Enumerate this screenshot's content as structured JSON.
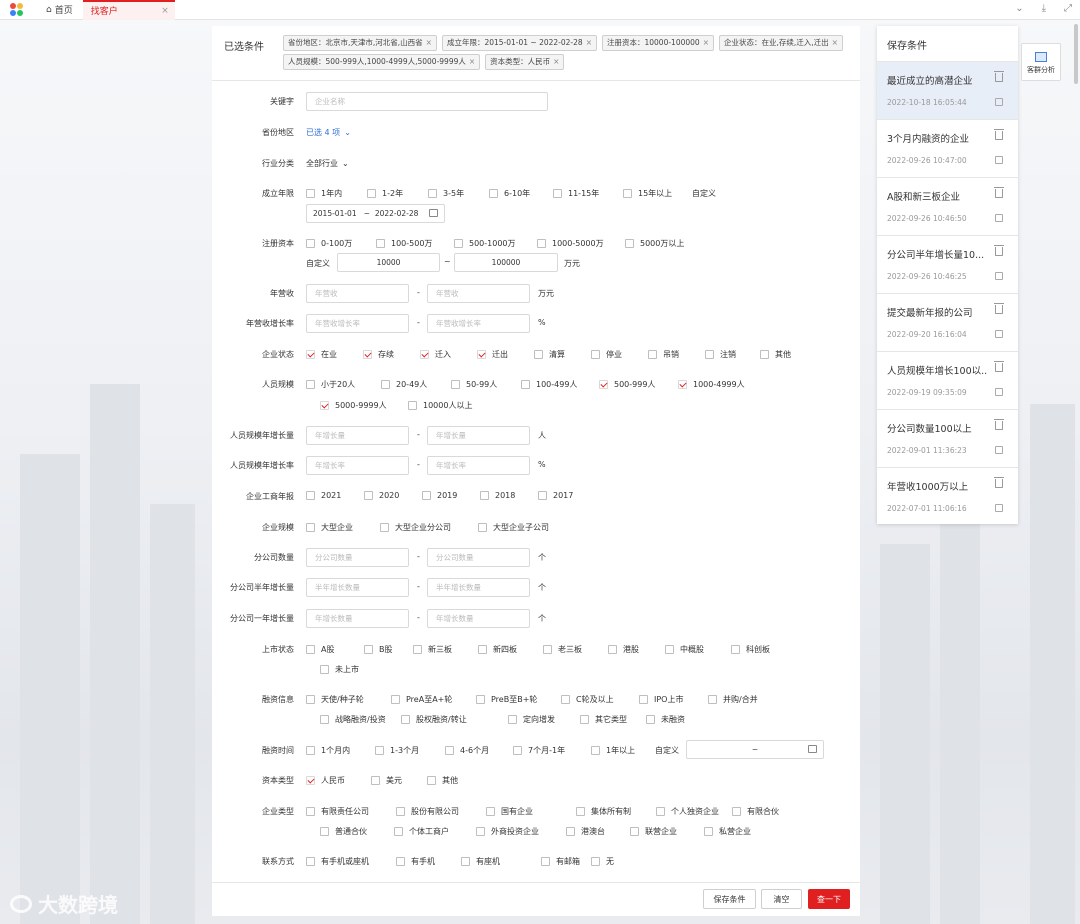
{
  "nav": {
    "home": "首页",
    "tab": "找客户"
  },
  "chosen": {
    "title": "已选条件",
    "tags": [
      "省份地区：北京市,天津市,河北省,山西省",
      "成立年限：2015-01-01 ~ 2022-02-28",
      "注册资本：10000-100000",
      "企业状态：在业,存续,迁入,迁出",
      "人员规模：500-999人,1000-4999人,5000-9999人",
      "资本类型：人民币"
    ]
  },
  "form": {
    "keyword": {
      "label": "关键字",
      "placeholder": "企业名称"
    },
    "province": {
      "label": "省份地区",
      "value": "已选 4 项"
    },
    "industry": {
      "label": "行业分类",
      "value": "全部行业"
    },
    "years": {
      "label": "成立年限",
      "options": [
        "1年内",
        "1-2年",
        "3-5年",
        "6-10年",
        "11-15年",
        "15年以上"
      ],
      "custom": "自定义",
      "from": "2015-01-01",
      "sep": "~",
      "to": "2022-02-28"
    },
    "capital": {
      "label": "注册资本",
      "options": [
        "0-100万",
        "100-500万",
        "500-1000万",
        "1000-5000万",
        "5000万以上"
      ],
      "custom": "自定义",
      "from": "10000",
      "sep": "~",
      "to": "100000",
      "unit": "万元"
    },
    "revenue": {
      "label": "年营收",
      "ph1": "年营收",
      "ph2": "年营收",
      "dash": "-",
      "unit": "万元"
    },
    "revenue_growth": {
      "label": "年营收增长率",
      "ph1": "年营收增长率",
      "ph2": "年营收增长率",
      "dash": "-",
      "unit": "%"
    },
    "status": {
      "label": "企业状态",
      "options": [
        {
          "t": "在业",
          "c": true
        },
        {
          "t": "存续",
          "c": true
        },
        {
          "t": "迁入",
          "c": true
        },
        {
          "t": "迁出",
          "c": true
        },
        {
          "t": "清算",
          "c": false
        },
        {
          "t": "停业",
          "c": false
        },
        {
          "t": "吊销",
          "c": false
        },
        {
          "t": "注销",
          "c": false
        },
        {
          "t": "其他",
          "c": false
        }
      ]
    },
    "staff": {
      "label": "人员规模",
      "options": [
        {
          "t": "小于20人",
          "c": false
        },
        {
          "t": "20-49人",
          "c": false
        },
        {
          "t": "50-99人",
          "c": false
        },
        {
          "t": "100-499人",
          "c": false
        },
        {
          "t": "500-999人",
          "c": true
        },
        {
          "t": "1000-4999人",
          "c": true
        },
        {
          "t": "5000-9999人",
          "c": true
        },
        {
          "t": "10000人以上",
          "c": false
        }
      ]
    },
    "staff_growth": {
      "label": "人员规模年增长量",
      "ph1": "年增长量",
      "ph2": "年增长量",
      "dash": "-",
      "unit": "人"
    },
    "staff_rate": {
      "label": "人员规模年增长率",
      "ph1": "年增长率",
      "ph2": "年增长率",
      "dash": "-",
      "unit": "%"
    },
    "annual_report": {
      "label": "企业工商年报",
      "options": [
        "2021",
        "2020",
        "2019",
        "2018",
        "2017"
      ]
    },
    "scale": {
      "label": "企业规模",
      "options": [
        "大型企业",
        "大型企业分公司",
        "大型企业子公司"
      ]
    },
    "branch_count": {
      "label": "分公司数量",
      "ph1": "分公司数量",
      "ph2": "分公司数量",
      "dash": "-",
      "unit": "个"
    },
    "branch_half": {
      "label": "分公司半年增长量",
      "ph1": "半年增长数量",
      "ph2": "半年增长数量",
      "dash": "-",
      "unit": "个"
    },
    "branch_year": {
      "label": "分公司一年增长量",
      "ph1": "年增长数量",
      "ph2": "年增长数量",
      "dash": "-",
      "unit": "个"
    },
    "listing": {
      "label": "上市状态",
      "options": [
        "A股",
        "B股",
        "新三板",
        "新四板",
        "老三板",
        "港股",
        "中概股",
        "科创板",
        "未上市"
      ]
    },
    "financing": {
      "label": "融资信息",
      "options": [
        "天使/种子轮",
        "PreA至A+轮",
        "PreB至B+轮",
        "C轮及以上",
        "IPO上市",
        "并购/合并",
        "战略融资/投资",
        "股权融资/转让",
        "定向增发",
        "其它类型",
        "未融资"
      ]
    },
    "fin_time": {
      "label": "融资时间",
      "options": [
        "1个月内",
        "1-3个月",
        "4-6个月",
        "7个月-1年",
        "1年以上"
      ],
      "custom": "自定义",
      "sep": "~"
    },
    "cap_type": {
      "label": "资本类型",
      "options": [
        {
          "t": "人民币",
          "c": true
        },
        {
          "t": "美元",
          "c": false
        },
        {
          "t": "其他",
          "c": false
        }
      ]
    },
    "ent_type": {
      "label": "企业类型",
      "options": [
        "有限责任公司",
        "股份有限公司",
        "国有企业",
        "集体所有制",
        "个人独资企业",
        "有限合伙",
        "普通合伙",
        "个体工商户",
        "外商投资企业",
        "港澳台",
        "联营企业",
        "私营企业"
      ]
    },
    "contact": {
      "label": "联系方式",
      "options": [
        "有手机或座机",
        "有手机",
        "有座机",
        "有邮箱",
        "无"
      ]
    }
  },
  "footer": {
    "save": "保存条件",
    "clear": "清空",
    "search": "查一下"
  },
  "saved": {
    "title": "保存条件",
    "items": [
      {
        "name": "最近成立的高潜企业",
        "time": "2022-10-18 16:05:44"
      },
      {
        "name": "3个月内融资的企业",
        "time": "2022-09-26 10:47:00"
      },
      {
        "name": "A股和新三板企业",
        "time": "2022-09-26 10:46:50"
      },
      {
        "name": "分公司半年增长量10...",
        "time": "2022-09-26 10:46:25"
      },
      {
        "name": "提交最新年报的公司",
        "time": "2022-09-20 16:16:04"
      },
      {
        "name": "人员规模年增长100以...",
        "time": "2022-09-19 09:35:09"
      },
      {
        "name": "分公司数量100以上",
        "time": "2022-09-01 11:36:23"
      },
      {
        "name": "年营收1000万以上",
        "time": "2022-07-01 11:06:16"
      }
    ]
  },
  "analysis": "客群分析",
  "watermark": "大数跨境",
  "colors": {
    "accent": "#e02020",
    "link": "#2f6fd6"
  }
}
